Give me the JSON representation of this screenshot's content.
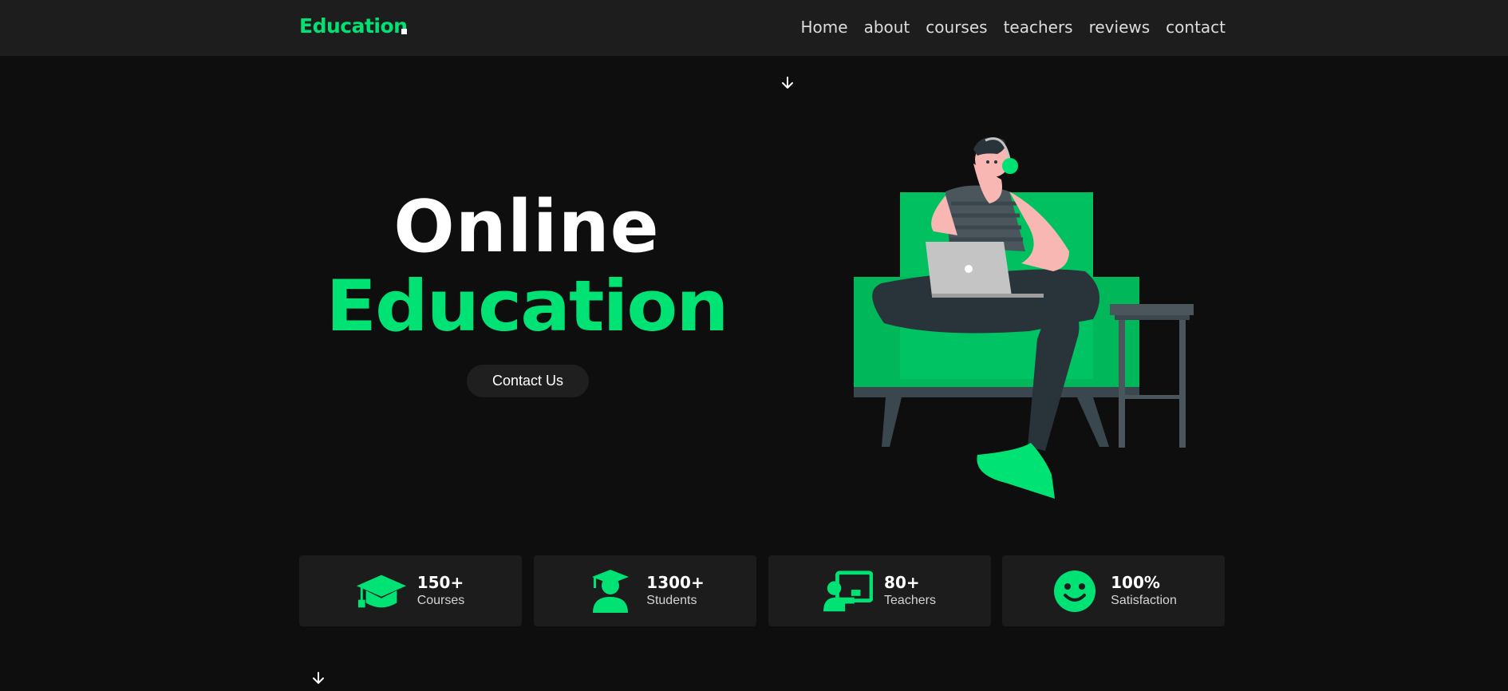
{
  "header": {
    "logo": "Education",
    "nav": [
      "Home",
      "about",
      "courses",
      "teachers",
      "reviews",
      "contact"
    ]
  },
  "hero": {
    "title_line1": "Online",
    "title_line2": "Education",
    "cta_label": "Contact Us"
  },
  "stats": [
    {
      "value": "150+",
      "label": "Courses",
      "icon": "graduation-cap-icon"
    },
    {
      "value": "1300+",
      "label": "Students",
      "icon": "student-icon"
    },
    {
      "value": "80+",
      "label": "Teachers",
      "icon": "teacher-board-icon"
    },
    {
      "value": "100%",
      "label": "Satisfaction",
      "icon": "smile-icon"
    }
  ],
  "colors": {
    "accent": "#00e274",
    "background": "#0e0e0e",
    "header_bg": "#1d1d1d",
    "card_bg": "#1c1c1c"
  }
}
